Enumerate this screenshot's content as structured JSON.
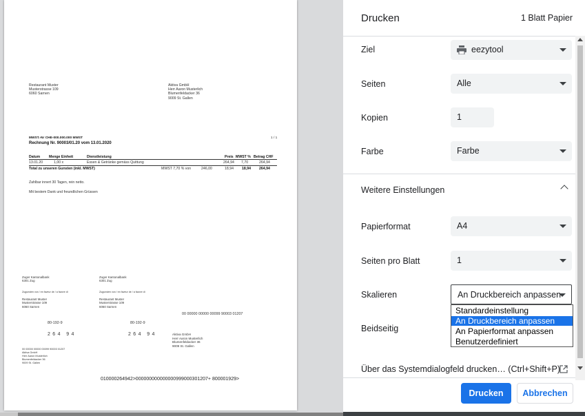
{
  "preview": {
    "sender": [
      "Restaurant Muster",
      "Musterstrasse 109",
      "6060 Sarnen"
    ],
    "recipient": [
      "Aktiva GmbH",
      "Herr Aaron Musterlich",
      "Blumenfeldacker 36",
      "9009 St. Gallen"
    ],
    "vat_line": "MWST.-Nr CHE-000.000.000 MWST",
    "page_no": "1 / 1",
    "invoice_title": "Rechnung Nr. 90003/01.20 vom 13.01.2020",
    "table_headers": [
      "Datum",
      "Menge Einheit",
      "Dienstleistung",
      "Preis",
      "MWST %",
      "Betrag CHF"
    ],
    "table_row": [
      "13.01.20",
      "1,00 x",
      "Essen & Getränke gemäss Quittung",
      "264,94",
      "7,70",
      "264,94"
    ],
    "total_row": [
      "Total zu unseren Gunsten (inkl. MWST)",
      "MWST 7,70 % von",
      "246,00",
      "18,94",
      "18,94",
      "264,94"
    ],
    "payment_terms": "Zahlbar innert 30 Tagen, rein netto.",
    "greeting": "Mit bestem Dank und freundlichen Grüssen",
    "slip_bank": [
      "Zuger Kantonalbank",
      "6301 Zug"
    ],
    "slip_for_text": "Zugunsten von / en faveur de / a favore di",
    "slip_payee": [
      "Restaurant Muster",
      "Musterstrasse 109",
      "6060 Sarnen"
    ],
    "slip_ref_number": "00 00000 00000 00099 90003 01207",
    "slip_account": "80-192-9",
    "slip_amount": "264 94",
    "slip_payer": [
      "Aktiva GmbH",
      "Herr Aaron Musterlich",
      "Blumenfeldacker 36",
      "9009 St. Gallen"
    ],
    "slip_ref_small": "00 00000 00000 00099 90003 01207",
    "coding_line": "010000264942>000000000000000999000301207+ 800001929>"
  },
  "panel": {
    "title": "Drucken",
    "sheets": "1 Blatt Papier",
    "ziel_label": "Ziel",
    "ziel_value": "eezytool",
    "seiten_label": "Seiten",
    "seiten_value": "Alle",
    "kopien_label": "Kopien",
    "kopien_value": "1",
    "farbe_label": "Farbe",
    "farbe_value": "Farbe",
    "more_label": "Weitere Einstellungen",
    "papier_label": "Papierformat",
    "papier_value": "A4",
    "spb_label": "Seiten pro Blatt",
    "spb_value": "1",
    "skal_label": "Skalieren",
    "skal_value": "An Druckbereich anpassen",
    "skal_options": [
      "Standardeinstellung",
      "An Druckbereich anpassen",
      "An Papierformat anpassen",
      "Benutzerdefiniert"
    ],
    "beidseitig_label": "Beidseitig",
    "sysdlg_label": "Über das Systemdialogfeld drucken… (Ctrl+Shift+P)",
    "print_button": "Drucken",
    "cancel_button": "Abbrechen"
  },
  "colors": {
    "accent": "#1a73e8",
    "preview_bg": "#d9dadc"
  }
}
